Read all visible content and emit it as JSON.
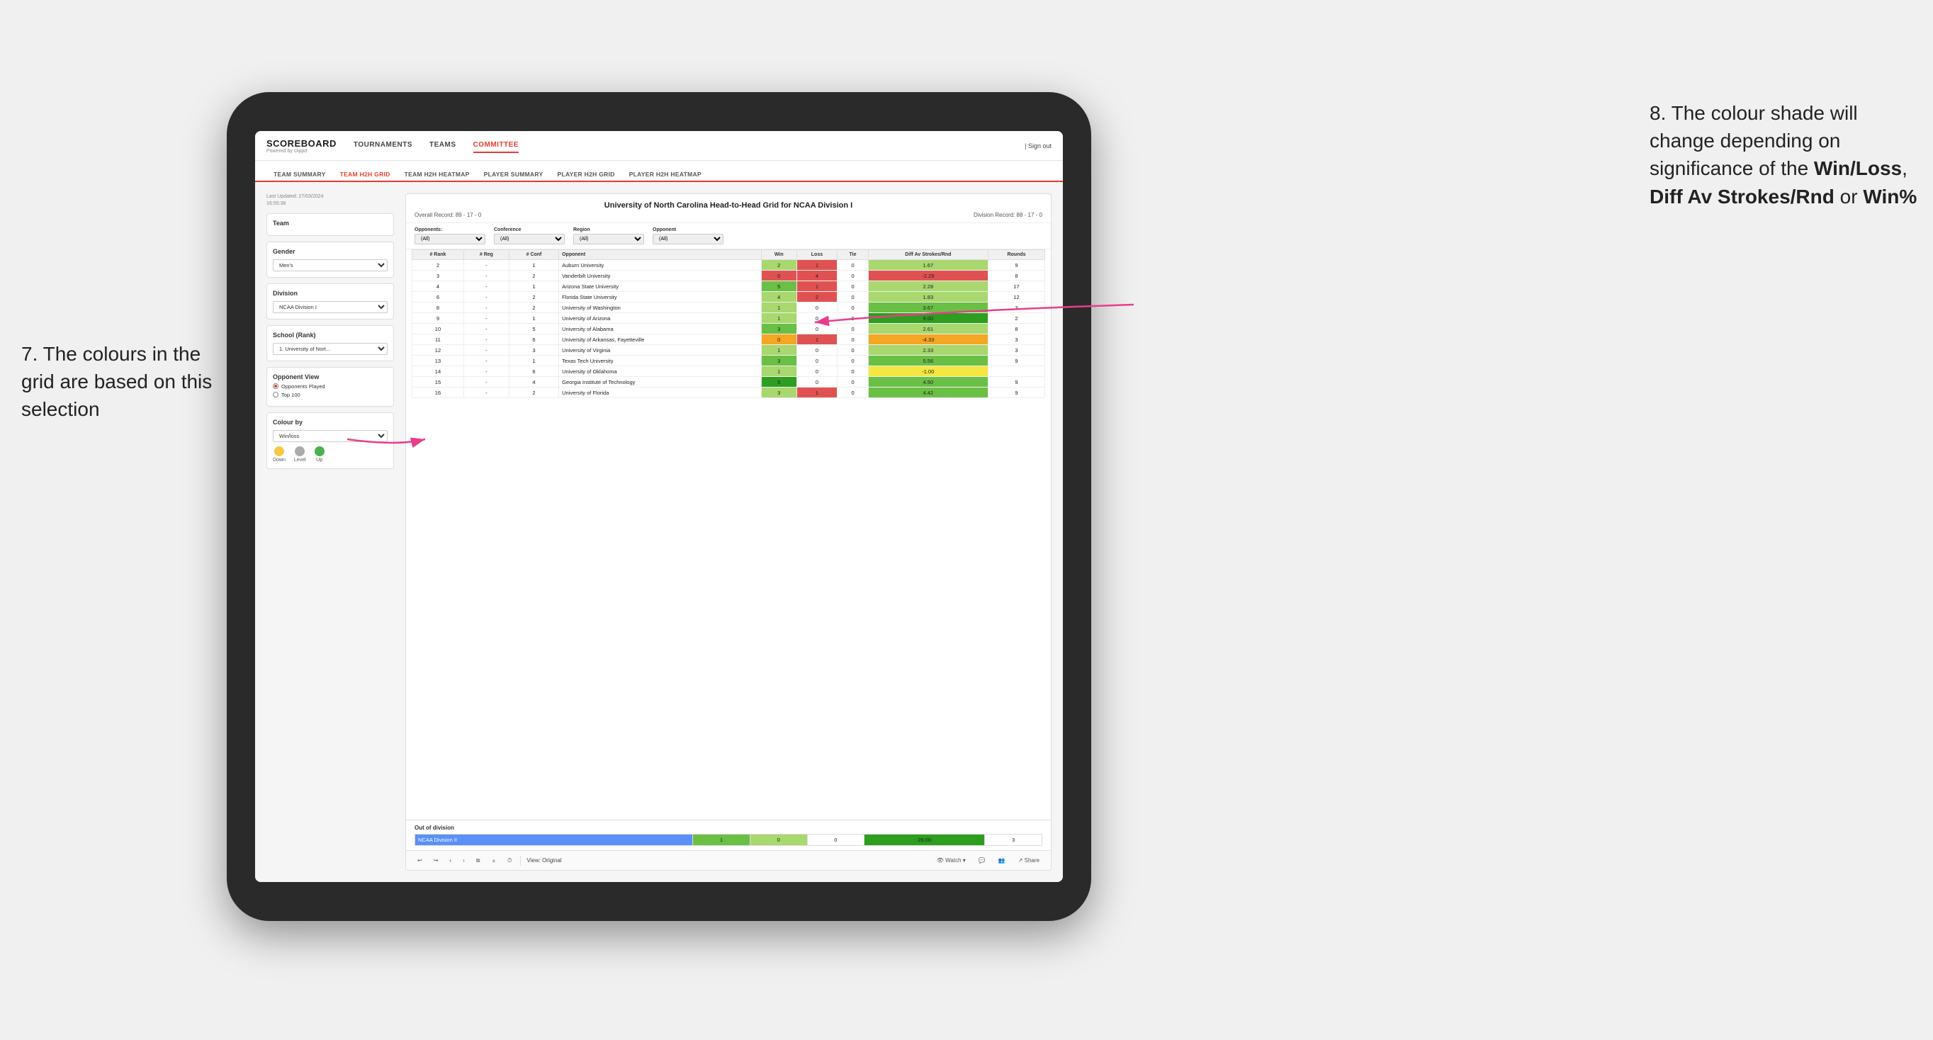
{
  "annotations": {
    "left_text": "7. The colours in the grid are based on this selection",
    "right_text_1": "8. The colour shade will change depending on significance of the ",
    "right_bold_1": "Win/Loss",
    "right_text_2": ", ",
    "right_bold_2": "Diff Av Strokes/Rnd",
    "right_text_3": " or ",
    "right_bold_3": "Win%"
  },
  "header": {
    "logo": "SCOREBOARD",
    "logo_sub": "Powered by clippd",
    "nav": [
      "TOURNAMENTS",
      "TEAMS",
      "COMMITTEE"
    ],
    "sign_out": "Sign out"
  },
  "sub_nav": [
    "TEAM SUMMARY",
    "TEAM H2H GRID",
    "TEAM H2H HEATMAP",
    "PLAYER SUMMARY",
    "PLAYER H2H GRID",
    "PLAYER H2H HEATMAP"
  ],
  "active_sub_nav": "TEAM H2H GRID",
  "sidebar": {
    "last_updated_label": "Last Updated: 27/03/2024",
    "last_updated_time": "16:55:38",
    "team_label": "Team",
    "gender_label": "Gender",
    "gender_value": "Men's",
    "division_label": "Division",
    "division_value": "NCAA Division I",
    "school_label": "School (Rank)",
    "school_value": "1. University of Nort...",
    "opponent_view_label": "Opponent View",
    "opponent_played": "Opponents Played",
    "top100": "Top 100",
    "colour_by_label": "Colour by",
    "colour_by_value": "Win/loss",
    "legend_down": "Down",
    "legend_level": "Level",
    "legend_up": "Up"
  },
  "grid": {
    "title": "University of North Carolina Head-to-Head Grid for NCAA Division I",
    "overall_record_label": "Overall Record:",
    "overall_record": "89 - 17 - 0",
    "division_record_label": "Division Record:",
    "division_record": "88 - 17 - 0",
    "filters": {
      "opponents_label": "Opponents:",
      "opponents_value": "(All)",
      "conference_label": "Conference",
      "conference_value": "(All)",
      "region_label": "Region",
      "region_value": "(All)",
      "opponent_label": "Opponent",
      "opponent_value": "(All)"
    },
    "columns": [
      "# Rank",
      "# Reg",
      "# Conf",
      "Opponent",
      "Win",
      "Loss",
      "Tie",
      "Diff Av Strokes/Rnd",
      "Rounds"
    ],
    "rows": [
      {
        "rank": "2",
        "reg": "-",
        "conf": "1",
        "opponent": "Auburn University",
        "win": "2",
        "loss": "1",
        "tie": "0",
        "diff": "1.67",
        "rounds": "9",
        "win_color": "green-light",
        "diff_color": "green-light"
      },
      {
        "rank": "3",
        "reg": "-",
        "conf": "2",
        "opponent": "Vanderbilt University",
        "win": "0",
        "loss": "4",
        "tie": "0",
        "diff": "-2.29",
        "rounds": "8",
        "win_color": "red",
        "diff_color": "red"
      },
      {
        "rank": "4",
        "reg": "-",
        "conf": "1",
        "opponent": "Arizona State University",
        "win": "5",
        "loss": "1",
        "tie": "0",
        "diff": "2.28",
        "rounds": "17",
        "win_color": "green-mid",
        "diff_color": "green-light"
      },
      {
        "rank": "6",
        "reg": "-",
        "conf": "2",
        "opponent": "Florida State University",
        "win": "4",
        "loss": "2",
        "tie": "0",
        "diff": "1.83",
        "rounds": "12",
        "win_color": "green-light",
        "diff_color": "green-light"
      },
      {
        "rank": "8",
        "reg": "-",
        "conf": "2",
        "opponent": "University of Washington",
        "win": "1",
        "loss": "0",
        "tie": "0",
        "diff": "3.67",
        "rounds": "3",
        "win_color": "green-light",
        "diff_color": "green-mid"
      },
      {
        "rank": "9",
        "reg": "-",
        "conf": "1",
        "opponent": "University of Arizona",
        "win": "1",
        "loss": "0",
        "tie": "0",
        "diff": "9.00",
        "rounds": "2",
        "win_color": "green-light",
        "diff_color": "green-dark"
      },
      {
        "rank": "10",
        "reg": "-",
        "conf": "5",
        "opponent": "University of Alabama",
        "win": "3",
        "loss": "0",
        "tie": "0",
        "diff": "2.61",
        "rounds": "8",
        "win_color": "green-mid",
        "diff_color": "green-light"
      },
      {
        "rank": "11",
        "reg": "-",
        "conf": "6",
        "opponent": "University of Arkansas, Fayetteville",
        "win": "0",
        "loss": "1",
        "tie": "0",
        "diff": "-4.33",
        "rounds": "3",
        "win_color": "orange",
        "diff_color": "orange"
      },
      {
        "rank": "12",
        "reg": "-",
        "conf": "3",
        "opponent": "University of Virginia",
        "win": "1",
        "loss": "0",
        "tie": "0",
        "diff": "2.33",
        "rounds": "3",
        "win_color": "green-light",
        "diff_color": "green-light"
      },
      {
        "rank": "13",
        "reg": "-",
        "conf": "1",
        "opponent": "Texas Tech University",
        "win": "3",
        "loss": "0",
        "tie": "0",
        "diff": "5.56",
        "rounds": "9",
        "win_color": "green-mid",
        "diff_color": "green-mid"
      },
      {
        "rank": "14",
        "reg": "-",
        "conf": "6",
        "opponent": "University of Oklahoma",
        "win": "1",
        "loss": "0",
        "tie": "0",
        "diff": "-1.00",
        "rounds": "",
        "win_color": "green-light",
        "diff_color": "yellow"
      },
      {
        "rank": "15",
        "reg": "-",
        "conf": "4",
        "opponent": "Georgia Institute of Technology",
        "win": "5",
        "loss": "0",
        "tie": "0",
        "diff": "4.50",
        "rounds": "9",
        "win_color": "green-dark",
        "diff_color": "green-mid"
      },
      {
        "rank": "16",
        "reg": "-",
        "conf": "2",
        "opponent": "University of Florida",
        "win": "3",
        "loss": "1",
        "tie": "0",
        "diff": "4.42",
        "rounds": "9",
        "win_color": "green-light",
        "diff_color": "green-mid"
      }
    ],
    "out_of_division_label": "Out of division",
    "out_row": {
      "division": "NCAA Division II",
      "win": "1",
      "loss": "0",
      "tie": "0",
      "diff": "26.00",
      "rounds": "3"
    }
  },
  "toolbar": {
    "view_label": "View: Original",
    "watch_label": "Watch",
    "share_label": "Share"
  }
}
